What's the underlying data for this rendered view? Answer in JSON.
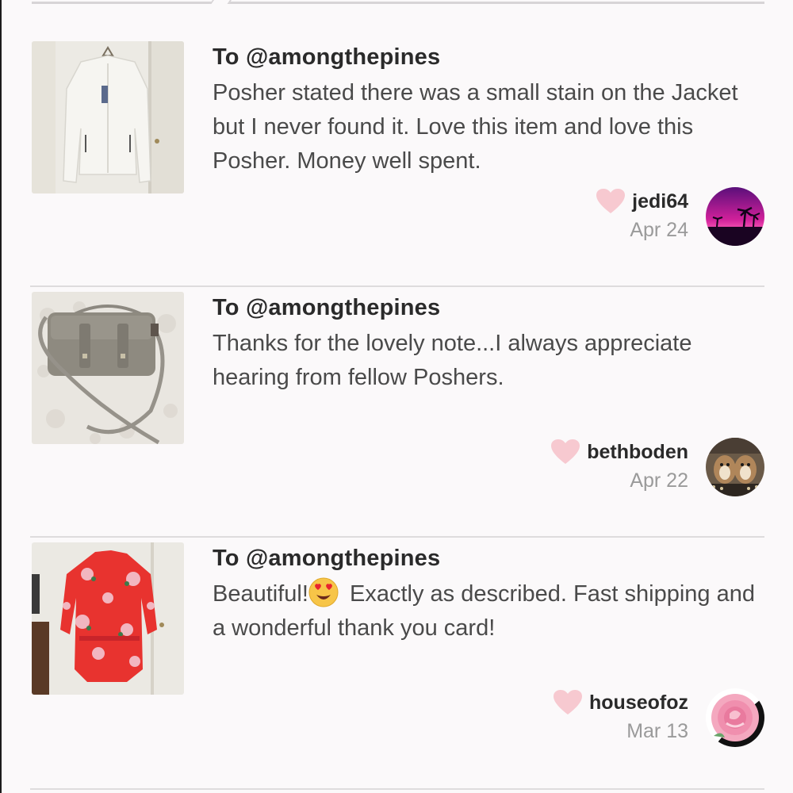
{
  "feedback": [
    {
      "to_prefix": "To ",
      "to_user": "@amongthepines",
      "comment": "Posher stated there was a small stain on the Jacket but I never found it. Love this item and love this Posher. Money well spent.",
      "username": "jedi64",
      "date": "Apr 24",
      "thumb_icon": "white-jacket-photo",
      "avatar_icon": "sunset-palms-avatar"
    },
    {
      "to_prefix": "To ",
      "to_user": "@amongthepines",
      "comment": "Thanks for the lovely note...I always appreciate hearing from fellow Poshers.",
      "username": "bethboden",
      "date": "Apr 22",
      "thumb_icon": "gray-handbag-photo",
      "avatar_icon": "chipmunks-avatar"
    },
    {
      "to_prefix": "To ",
      "to_user": "@amongthepines",
      "comment_before_emoji": "Beautiful!",
      "emoji": "heart-eyes-emoji",
      "comment_after_emoji": " Exactly as described. Fast shipping and a wonderful thank you card!",
      "username": "houseofoz",
      "date": "Mar 13",
      "thumb_icon": "red-floral-robe-photo",
      "avatar_icon": "pink-rose-avatar"
    }
  ],
  "colors": {
    "background": "#fbf9fa",
    "heart": "#f7c9d0",
    "text_primary": "#2a2a2a",
    "text_secondary": "#4a4a4a",
    "date": "#9a9a9a",
    "divider": "#dedcdd"
  }
}
